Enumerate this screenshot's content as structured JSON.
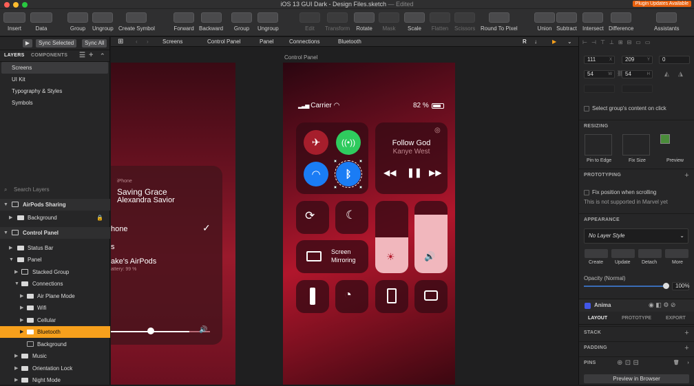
{
  "window": {
    "title": "iOS 13 GUI Dark - Design Files.sketch",
    "edited": "— Edited",
    "plugin_badge": "Plugin Updates Available"
  },
  "toolbar": {
    "insert": "Insert",
    "data": "Data",
    "group": "Group",
    "ungroup": "Ungroup",
    "create_symbol": "Create Symbol",
    "forward": "Forward",
    "backward": "Backward",
    "group2": "Group",
    "ungroup2": "Ungroup",
    "edit": "Edit",
    "transform": "Transform",
    "rotate": "Rotate",
    "mask": "Mask",
    "scale": "Scale",
    "flatten": "Flatten",
    "scissors": "Scissors",
    "round": "Round To Pixel",
    "union": "Union",
    "subtract": "Subtract",
    "intersect": "Intersect",
    "difference": "Difference",
    "assistants": "Assistants"
  },
  "left": {
    "sync_selected": "Sync Selected",
    "sync_all": "Sync All",
    "tab_layers": "LAYERS",
    "tab_components": "COMPONENTS",
    "pages": [
      "Screens",
      "UI Kit",
      "Typography & Styles",
      "Symbols"
    ],
    "search_placeholder": "Search Layers",
    "layers": [
      "AirPods Sharing",
      "Background",
      "Control Panel",
      "Status Bar",
      "Panel",
      "Stacked Group",
      "Connections",
      "Air Plane Mode",
      "Wifi",
      "Cellular",
      "Bluetooth",
      "Background",
      "Music",
      "Orientation Lock",
      "Night Mode"
    ]
  },
  "breadcrumb": [
    "Screens",
    "Control Panel",
    "Panel",
    "Connections",
    "Bluetooth"
  ],
  "artboard": {
    "label": "Control Panel",
    "carrier": "Carrier",
    "battery": "82 %",
    "song": "Follow God",
    "artist": "Kanye West",
    "mirroring1": "Screen",
    "mirroring2": "Mirroring"
  },
  "artleft": {
    "device_label": "iPhone",
    "song": "Saving Grace",
    "artist": "Alexandra Savior",
    "row1": "hone",
    "row2": "s",
    "row3": "ake's AirPods",
    "row3sub": "attery: 99 %"
  },
  "right": {
    "x": "111",
    "y": "209",
    "rot": "0",
    "w": "54",
    "h": "54",
    "unit_x": "X",
    "unit_y": "Y",
    "unit_w": "W",
    "unit_h": "H",
    "select_group": "Select group's content on click",
    "resizing": "RESIZING",
    "pin": "Pin to Edge",
    "fix": "Fix Size",
    "preview": "Preview",
    "prototyping": "PROTOTYPING",
    "fix_scroll": "Fix position when scrolling",
    "not_supported": "This is not supported in Marvel yet",
    "appearance": "APPEARANCE",
    "layer_style": "No Layer Style",
    "create": "Create",
    "update": "Update",
    "detach": "Detach",
    "more": "More",
    "opacity_label": "Opacity (Normal)",
    "opacity": "100%",
    "opacity_fraction": 1.0,
    "anima": "Anima",
    "tab_layout": "LAYOUT",
    "tab_prototype": "PROTOTYPE",
    "tab_export": "EXPORT",
    "stack": "STACK",
    "padding": "PADDING",
    "pins": "PINS",
    "preview_browser": "Preview in Browser"
  },
  "colors": {
    "accent": "#f7a01c",
    "bt_blue": "#1a7cf5",
    "green": "#2fcb5e",
    "airplane": "#a61e2c"
  }
}
